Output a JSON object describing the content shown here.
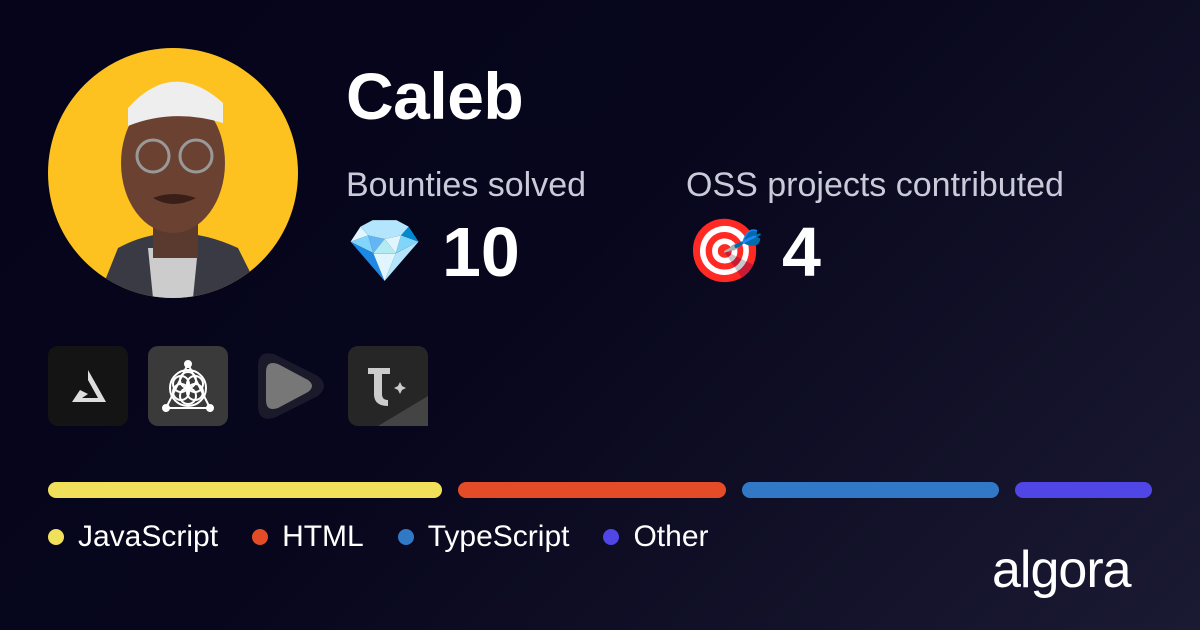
{
  "user": {
    "name": "Caleb"
  },
  "stats": [
    {
      "label": "Bounties solved",
      "icon": "gem-icon",
      "emoji": "💎",
      "value": "10"
    },
    {
      "label": "OSS projects contributed",
      "icon": "target-icon",
      "emoji": "🎯",
      "value": "4"
    }
  ],
  "orgs": [
    "triangle-logo",
    "flower-of-life-logo",
    "play-logo",
    "t-sparkle-logo"
  ],
  "languages": [
    {
      "name": "JavaScript",
      "color": "#f1e05a",
      "share": 37.3
    },
    {
      "name": "HTML",
      "color": "#e34c26",
      "share": 25.4
    },
    {
      "name": "TypeScript",
      "color": "#3178c6",
      "share": 24.3
    },
    {
      "name": "Other",
      "color": "#4f46e5",
      "share": 13.0
    }
  ],
  "brand": "algora"
}
